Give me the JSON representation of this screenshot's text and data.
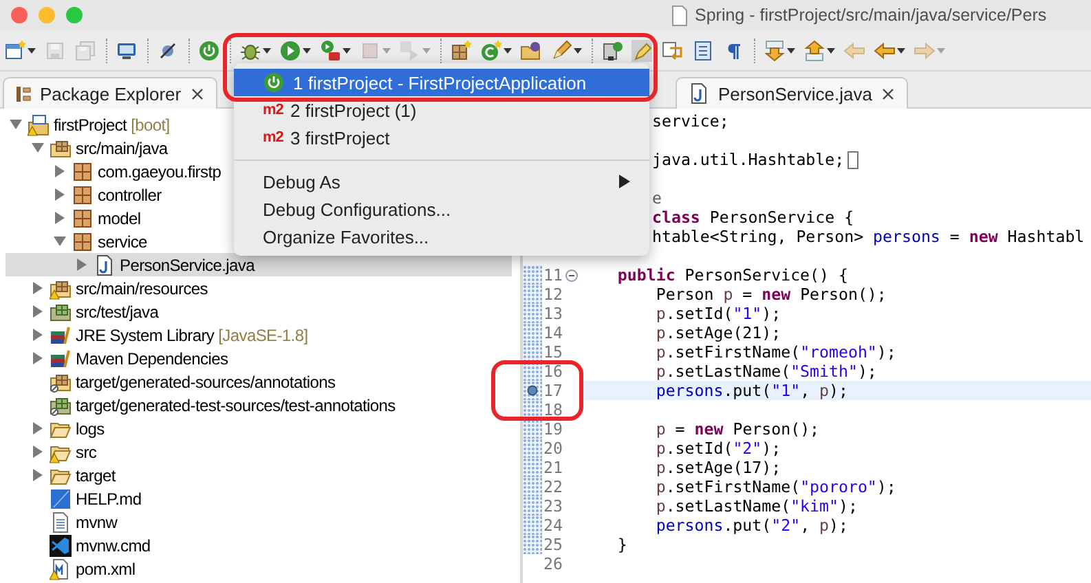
{
  "window": {
    "title": "Spring - firstProject/src/main/java/service/Pers"
  },
  "toolbar": [
    {
      "kind": "new",
      "dropdown": true,
      "disabled": false
    },
    {
      "kind": "save",
      "dropdown": false,
      "disabled": true
    },
    {
      "kind": "saveall",
      "dropdown": false,
      "disabled": true
    },
    {
      "kind": "separator"
    },
    {
      "kind": "monitor",
      "dropdown": false,
      "disabled": false
    },
    {
      "kind": "separator"
    },
    {
      "kind": "skip",
      "dropdown": false,
      "disabled": false
    },
    {
      "kind": "separator"
    },
    {
      "kind": "boot",
      "dropdown": false,
      "disabled": false
    },
    {
      "kind": "separator"
    },
    {
      "kind": "debug",
      "dropdown": true,
      "disabled": false
    },
    {
      "kind": "run",
      "dropdown": true,
      "disabled": false
    },
    {
      "kind": "tool",
      "dropdown": true,
      "disabled": false
    },
    {
      "kind": "stop",
      "dropdown": true,
      "disabled": true
    },
    {
      "kind": "relaunch",
      "dropdown": true,
      "disabled": true
    },
    {
      "kind": "separator"
    },
    {
      "kind": "package",
      "dropdown": false,
      "disabled": false
    },
    {
      "kind": "class",
      "dropdown": true,
      "disabled": false
    },
    {
      "kind": "opentype",
      "dropdown": false,
      "disabled": false
    },
    {
      "kind": "edit",
      "dropdown": true,
      "disabled": false
    },
    {
      "kind": "separator"
    },
    {
      "kind": "task",
      "dropdown": false,
      "disabled": false
    },
    {
      "kind": "highlight",
      "dropdown": false,
      "disabled": false
    },
    {
      "kind": "wrap",
      "dropdown": false,
      "disabled": false
    },
    {
      "kind": "block",
      "dropdown": false,
      "disabled": false
    },
    {
      "kind": "pilcrow",
      "dropdown": false,
      "disabled": false
    },
    {
      "kind": "separator"
    },
    {
      "kind": "next",
      "dropdown": true,
      "disabled": false
    },
    {
      "kind": "previous",
      "dropdown": true,
      "disabled": false
    },
    {
      "kind": "back",
      "dropdown": false,
      "disabled": true
    },
    {
      "kind": "back",
      "dropdown": true,
      "disabled": false
    },
    {
      "kind": "forward",
      "dropdown": true,
      "disabled": true
    }
  ],
  "package_explorer": {
    "tab": "Package Explorer",
    "tree": [
      {
        "label": "firstProject",
        "decoration": "[boot]",
        "kind": "project",
        "warning": true,
        "selected": false,
        "expanded": true,
        "children": [
          {
            "label": "src/main/java",
            "kind": "source",
            "warning": false,
            "selected": false,
            "expanded": true,
            "children": [
              {
                "label": "com.gaeyou.firstp",
                "kind": "package",
                "warning": false,
                "selected": false,
                "expanded": false
              },
              {
                "label": "controller",
                "kind": "package",
                "warning": false,
                "selected": false,
                "expanded": false
              },
              {
                "label": "model",
                "kind": "package",
                "warning": false,
                "selected": false,
                "expanded": false
              },
              {
                "label": "service",
                "kind": "package",
                "warning": false,
                "selected": false,
                "expanded": true,
                "children": [
                  {
                    "label": "PersonService.java",
                    "kind": "java",
                    "warning": false,
                    "selected": true,
                    "expanded": false
                  }
                ]
              }
            ]
          },
          {
            "label": "src/main/resources",
            "kind": "source",
            "warning": true,
            "selected": false,
            "expanded": false
          },
          {
            "label": "src/test/java",
            "kind": "testsource",
            "warning": false,
            "selected": false,
            "expanded": false
          },
          {
            "label": "JRE System Library",
            "decoration": "[JavaSE-1.8]",
            "kind": "library",
            "warning": false,
            "selected": false,
            "expanded": false
          },
          {
            "label": "Maven Dependencies",
            "kind": "library",
            "warning": false,
            "selected": false,
            "expanded": false
          },
          {
            "label": "target/generated-sources/annotations",
            "kind": "gensource",
            "warning": false,
            "selected": false
          },
          {
            "label": "target/generated-test-sources/test-annotations",
            "kind": "gentestsource",
            "warning": false,
            "selected": false
          },
          {
            "label": "logs",
            "kind": "folder",
            "warning": false,
            "selected": false,
            "expanded": false
          },
          {
            "label": "src",
            "kind": "folder",
            "warning": true,
            "selected": false,
            "expanded": false
          },
          {
            "label": "target",
            "kind": "folder",
            "warning": false,
            "selected": false,
            "expanded": false
          },
          {
            "label": "HELP.md",
            "kind": "markdown",
            "warning": false,
            "selected": false
          },
          {
            "label": "mvnw",
            "kind": "text",
            "warning": false,
            "selected": false
          },
          {
            "label": "mvnw.cmd",
            "kind": "script",
            "warning": false,
            "selected": false
          },
          {
            "label": "pom.xml",
            "kind": "xml",
            "warning": true,
            "selected": false
          }
        ]
      }
    ]
  },
  "editor": {
    "tab": "PersonService.java",
    "lines": [
      {
        "kind": "code",
        "covered": true,
        "tokens": [
          {
            "text": "service;",
            "kind": "plain"
          }
        ]
      },
      {
        "kind": "blank"
      },
      {
        "kind": "code",
        "covered": true,
        "collapsed": true,
        "tokens": [
          {
            "text": "java.util.Hashtable;",
            "kind": "plain"
          }
        ]
      },
      {
        "kind": "blank"
      },
      {
        "kind": "code",
        "covered": true,
        "tokens": [
          {
            "text": "e",
            "kind": "annotation"
          }
        ]
      },
      {
        "kind": "code",
        "covered": true,
        "tokens": [
          {
            "text": "class",
            "kind": "keyword"
          },
          {
            "text": " PersonService {",
            "kind": "plain"
          }
        ]
      },
      {
        "kind": "code",
        "covered": true,
        "tokens": [
          {
            "text": "htable<String, Person> ",
            "kind": "plain"
          },
          {
            "text": "persons",
            "kind": "field"
          },
          {
            "text": " = ",
            "kind": "plain"
          },
          {
            "text": "new",
            "kind": "keyword"
          },
          {
            "text": " Hashtabl",
            "kind": "plain"
          }
        ]
      },
      {
        "kind": "blank",
        "changed": false
      },
      {
        "kind": "code",
        "number": "11",
        "changed": true,
        "current": false,
        "breakpoint": false,
        "expanded": true,
        "tokens": [
          {
            "text": "    public",
            "kind": "keyword"
          },
          {
            "text": " PersonService() {",
            "kind": "plain"
          }
        ]
      },
      {
        "kind": "code",
        "number": "12",
        "changed": true,
        "current": false,
        "breakpoint": false,
        "tokens": [
          {
            "text": "        Person ",
            "kind": "plain"
          },
          {
            "text": "p",
            "kind": "local"
          },
          {
            "text": " = ",
            "kind": "plain"
          },
          {
            "text": "new",
            "kind": "keyword"
          },
          {
            "text": " Person();",
            "kind": "plain"
          }
        ]
      },
      {
        "kind": "code",
        "number": "13",
        "changed": true,
        "current": false,
        "breakpoint": false,
        "tokens": [
          {
            "text": "        p",
            "kind": "local"
          },
          {
            "text": ".setId(",
            "kind": "plain"
          },
          {
            "text": "\"1\"",
            "kind": "string"
          },
          {
            "text": ");",
            "kind": "plain"
          }
        ]
      },
      {
        "kind": "code",
        "number": "14",
        "changed": true,
        "current": false,
        "breakpoint": false,
        "tokens": [
          {
            "text": "        p",
            "kind": "local"
          },
          {
            "text": ".setAge(21);",
            "kind": "plain"
          }
        ]
      },
      {
        "kind": "code",
        "number": "15",
        "changed": true,
        "current": false,
        "breakpoint": false,
        "tokens": [
          {
            "text": "        p",
            "kind": "local"
          },
          {
            "text": ".setFirstName(",
            "kind": "plain"
          },
          {
            "text": "\"romeoh\"",
            "kind": "string"
          },
          {
            "text": ");",
            "kind": "plain"
          }
        ]
      },
      {
        "kind": "code",
        "number": "16",
        "changed": true,
        "current": false,
        "breakpoint": false,
        "tokens": [
          {
            "text": "        p",
            "kind": "local"
          },
          {
            "text": ".setLastName(",
            "kind": "plain"
          },
          {
            "text": "\"Smith\"",
            "kind": "string"
          },
          {
            "text": ");",
            "kind": "plain"
          }
        ]
      },
      {
        "kind": "code",
        "number": "17",
        "changed": true,
        "current": true,
        "breakpoint": true,
        "tokens": [
          {
            "text": "        persons",
            "kind": "field"
          },
          {
            "text": ".put(",
            "kind": "plain"
          },
          {
            "text": "\"1\"",
            "kind": "string"
          },
          {
            "text": ", ",
            "kind": "plain"
          },
          {
            "text": "p",
            "kind": "local"
          },
          {
            "text": ");",
            "kind": "plain"
          }
        ]
      },
      {
        "kind": "blank",
        "number": "18",
        "changed": true,
        "current": false,
        "breakpoint": false
      },
      {
        "kind": "code",
        "number": "19",
        "changed": true,
        "current": false,
        "breakpoint": false,
        "tokens": [
          {
            "text": "        p",
            "kind": "local"
          },
          {
            "text": " = ",
            "kind": "plain"
          },
          {
            "text": "new",
            "kind": "keyword"
          },
          {
            "text": " Person();",
            "kind": "plain"
          }
        ]
      },
      {
        "kind": "code",
        "number": "20",
        "changed": true,
        "current": false,
        "breakpoint": false,
        "tokens": [
          {
            "text": "        p",
            "kind": "local"
          },
          {
            "text": ".setId(",
            "kind": "plain"
          },
          {
            "text": "\"2\"",
            "kind": "string"
          },
          {
            "text": ");",
            "kind": "plain"
          }
        ]
      },
      {
        "kind": "code",
        "number": "21",
        "changed": true,
        "current": false,
        "breakpoint": false,
        "tokens": [
          {
            "text": "        p",
            "kind": "local"
          },
          {
            "text": ".setAge(17);",
            "kind": "plain"
          }
        ]
      },
      {
        "kind": "code",
        "number": "22",
        "changed": true,
        "current": false,
        "breakpoint": false,
        "tokens": [
          {
            "text": "        p",
            "kind": "local"
          },
          {
            "text": ".setFirstName(",
            "kind": "plain"
          },
          {
            "text": "\"pororo\"",
            "kind": "string"
          },
          {
            "text": ");",
            "kind": "plain"
          }
        ]
      },
      {
        "kind": "code",
        "number": "23",
        "changed": true,
        "current": false,
        "breakpoint": false,
        "tokens": [
          {
            "text": "        p",
            "kind": "local"
          },
          {
            "text": ".setLastName(",
            "kind": "plain"
          },
          {
            "text": "\"kim\"",
            "kind": "string"
          },
          {
            "text": ");",
            "kind": "plain"
          }
        ]
      },
      {
        "kind": "code",
        "number": "24",
        "changed": true,
        "current": false,
        "breakpoint": false,
        "tokens": [
          {
            "text": "        persons",
            "kind": "field"
          },
          {
            "text": ".put(",
            "kind": "plain"
          },
          {
            "text": "\"2\"",
            "kind": "string"
          },
          {
            "text": ", ",
            "kind": "plain"
          },
          {
            "text": "p",
            "kind": "local"
          },
          {
            "text": ");",
            "kind": "plain"
          }
        ]
      },
      {
        "kind": "code",
        "number": "25",
        "changed": true,
        "current": false,
        "breakpoint": false,
        "tokens": [
          {
            "text": "    }",
            "kind": "plain"
          }
        ]
      },
      {
        "kind": "blank",
        "number": "26",
        "changed": false,
        "current": false,
        "breakpoint": false
      }
    ]
  },
  "run_menu": {
    "items": [
      {
        "kind": "boot",
        "label": "1 firstProject - FirstProjectApplication",
        "selected": true
      },
      {
        "kind": "maven",
        "badge": "m2",
        "label": "2 firstProject (1)",
        "selected": false
      },
      {
        "kind": "maven",
        "badge": "m2",
        "label": "3 firstProject",
        "selected": false
      },
      {
        "kind": "separator"
      },
      {
        "kind": "submenu",
        "label": "Debug As",
        "selected": false
      },
      {
        "kind": "action",
        "label": "Debug Configurations...",
        "selected": false
      },
      {
        "kind": "action",
        "label": "Organize Favorites...",
        "selected": false
      }
    ]
  },
  "annotations": [
    {
      "kind": "outline"
    },
    {
      "kind": "outline"
    }
  ]
}
